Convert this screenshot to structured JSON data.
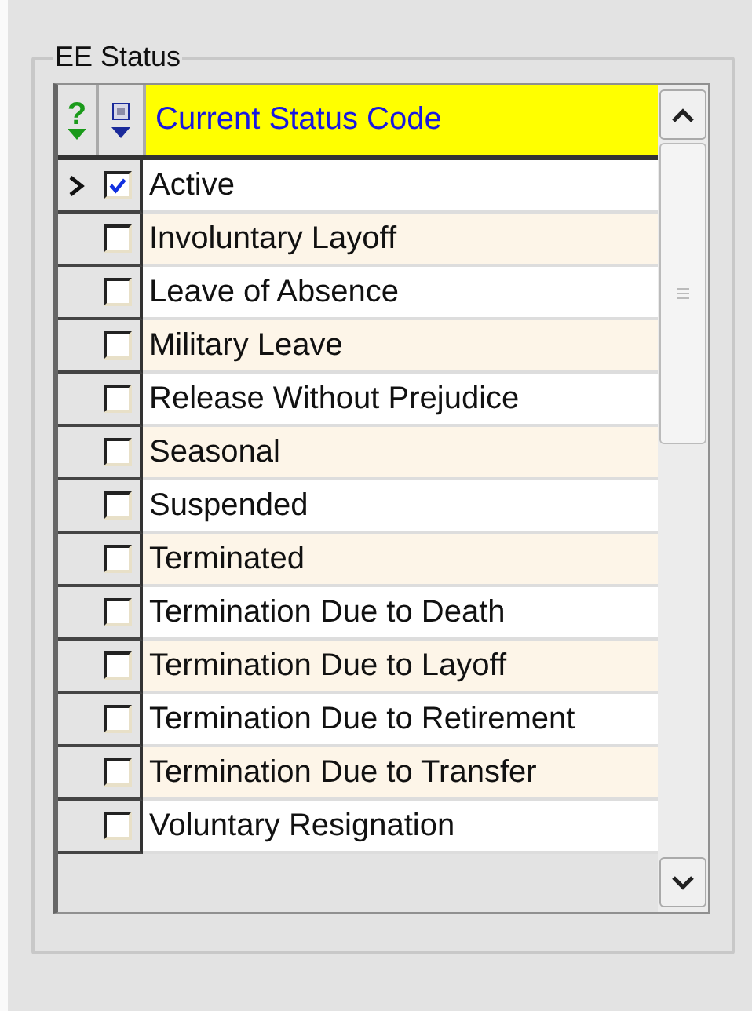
{
  "group": {
    "title": "EE Status"
  },
  "grid": {
    "header": {
      "help_icon": "?",
      "column": "Current Status Code"
    },
    "rows": [
      {
        "label": "Active",
        "checked": true,
        "current": true
      },
      {
        "label": "Involuntary Layoff",
        "checked": false,
        "current": false
      },
      {
        "label": "Leave of Absence",
        "checked": false,
        "current": false
      },
      {
        "label": "Military Leave",
        "checked": false,
        "current": false
      },
      {
        "label": "Release Without Prejudice",
        "checked": false,
        "current": false
      },
      {
        "label": "Seasonal",
        "checked": false,
        "current": false
      },
      {
        "label": "Suspended",
        "checked": false,
        "current": false
      },
      {
        "label": "Terminated",
        "checked": false,
        "current": false
      },
      {
        "label": "Termination Due to Death",
        "checked": false,
        "current": false
      },
      {
        "label": "Termination Due to Layoff",
        "checked": false,
        "current": false
      },
      {
        "label": "Termination Due to Retirement",
        "checked": false,
        "current": false
      },
      {
        "label": "Termination Due to Transfer",
        "checked": false,
        "current": false
      },
      {
        "label": "Voluntary Resignation",
        "checked": false,
        "current": false
      }
    ]
  }
}
